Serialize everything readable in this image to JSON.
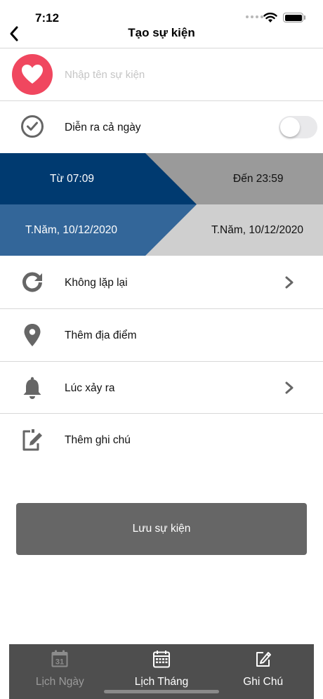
{
  "status_bar": {
    "time": "7:12"
  },
  "header": {
    "title": "Tạo sự kiện"
  },
  "event_name": {
    "placeholder": "Nhập tên sự kiện",
    "value": ""
  },
  "all_day": {
    "label": "Diễn ra cả ngày",
    "enabled": false
  },
  "date_range": {
    "from_time": "Từ 07:09",
    "to_time": "Đến 23:59",
    "from_date": "T.Năm, 10/12/2020",
    "to_date": "T.Năm, 10/12/2020"
  },
  "options": {
    "repeat": "Không lặp lại",
    "location": "Thêm địa điểm",
    "reminder": "Lúc xảy ra",
    "note": "Thêm ghi chú"
  },
  "save_button": "Lưu sự kiện",
  "tabs": [
    {
      "label": "Lịch Ngày",
      "icon": "calendar-day-icon",
      "day_number": "31",
      "active": false
    },
    {
      "label": "Lịch Tháng",
      "icon": "calendar-month-icon",
      "active": true
    },
    {
      "label": "Ghi Chú",
      "icon": "edit-note-icon",
      "active": true
    }
  ],
  "colors": {
    "accent_red": "#f0475f",
    "from_dark_blue": "#003a70",
    "from_blue": "#336699",
    "to_gray": "#9a9a9a",
    "to_light_gray": "#cfcfcf",
    "icon_gray": "#666666",
    "button_gray": "#666666",
    "tab_bar": "#4e4e4e"
  }
}
